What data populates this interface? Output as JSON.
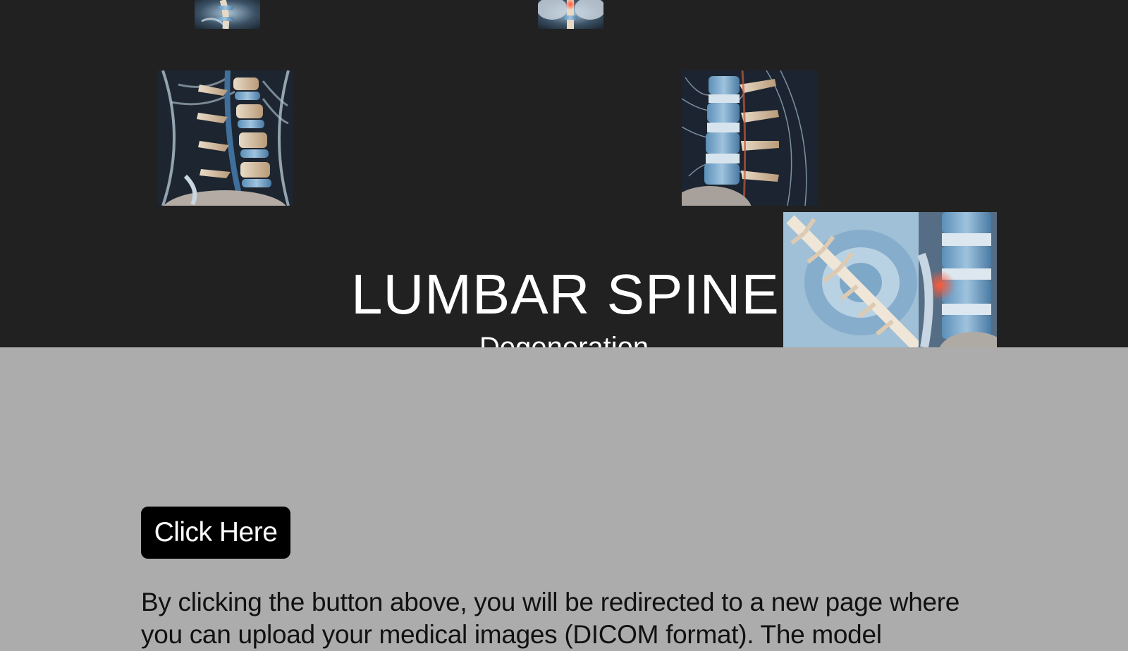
{
  "hero": {
    "title": "LUMBAR SPINE",
    "subtitle": "Degeneration",
    "images": [
      {
        "name": "spine-thumb-top-left",
        "depicts": "spine illustration"
      },
      {
        "name": "spine-thumb-top-center",
        "depicts": "spine illustration with red highlight"
      },
      {
        "name": "spine-image-left",
        "depicts": "lumbar spine side view"
      },
      {
        "name": "spine-image-right",
        "depicts": "lumbar spine with nerves"
      },
      {
        "name": "spine-image-composite",
        "depicts": "spine vertebrae and disc with red inflammation"
      }
    ]
  },
  "cta": {
    "label": "Click Here"
  },
  "description": "By clicking the button above, you will be redirected to a new page where you can upload your medical images (DICOM format). The model",
  "colors": {
    "hero_bg": "#212121",
    "page_bg": "#acacac",
    "button_bg": "#000000",
    "button_text": "#ffffff",
    "accent_red": "#d8361e",
    "bone_blue": "#7fa8c8"
  }
}
